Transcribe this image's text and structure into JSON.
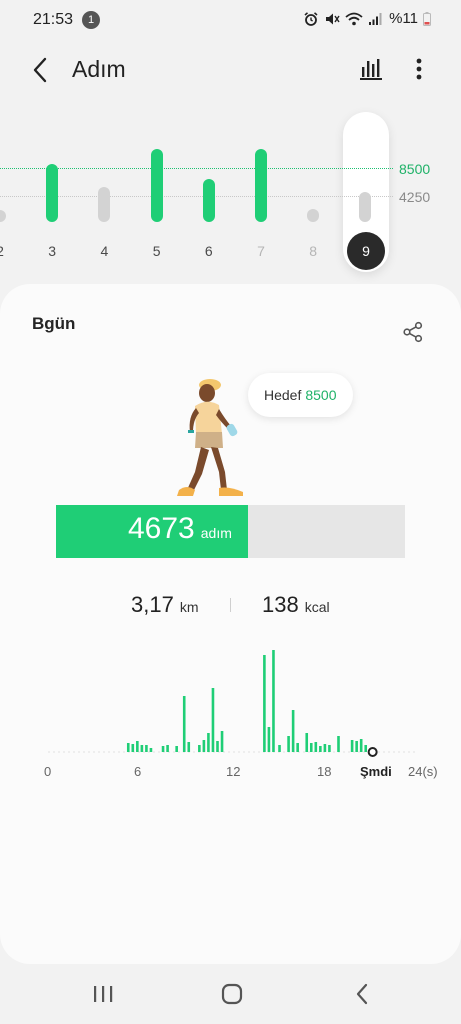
{
  "status_bar": {
    "time": "21:53",
    "notification_count": "1",
    "battery": "%11"
  },
  "app_bar": {
    "title": "Adım"
  },
  "week": {
    "goal_label": "8500",
    "half_goal_label": "4250",
    "selected_day": "9",
    "days": [
      {
        "label": "2",
        "steps": 1100,
        "reached": false,
        "dim": false
      },
      {
        "label": "3",
        "steps": 9100,
        "reached": true,
        "dim": false
      },
      {
        "label": "4",
        "steps": 5500,
        "reached": false,
        "dim": false
      },
      {
        "label": "5",
        "steps": 11500,
        "reached": true,
        "dim": false
      },
      {
        "label": "6",
        "steps": 6800,
        "reached": true,
        "dim": false
      },
      {
        "label": "7",
        "steps": 11500,
        "reached": true,
        "dim": true
      },
      {
        "label": "8",
        "steps": 2000,
        "reached": false,
        "dim": true
      },
      {
        "label": "9",
        "steps": 4673,
        "reached": false,
        "dim": false
      }
    ]
  },
  "today": {
    "title": "Bgün",
    "goal_text": "Hedef",
    "goal_value": "8500",
    "steps": "4673",
    "steps_unit": "adım",
    "progress_fraction": 0.55,
    "distance": "3,17",
    "distance_unit": "km",
    "calories": "138",
    "calories_unit": "kcal"
  },
  "chart_data": {
    "type": "bar",
    "x_ticks": [
      "0",
      "6",
      "12",
      "18",
      "Şmdi",
      "24(s)"
    ],
    "xlim": [
      0,
      24
    ],
    "ylim": [
      0,
      100
    ],
    "bars": [
      {
        "x": 5.3,
        "y": 9
      },
      {
        "x": 5.6,
        "y": 8
      },
      {
        "x": 5.9,
        "y": 11
      },
      {
        "x": 6.2,
        "y": 7
      },
      {
        "x": 6.5,
        "y": 7
      },
      {
        "x": 6.8,
        "y": 4
      },
      {
        "x": 7.6,
        "y": 6
      },
      {
        "x": 7.9,
        "y": 7
      },
      {
        "x": 8.5,
        "y": 6
      },
      {
        "x": 9.0,
        "y": 56
      },
      {
        "x": 9.3,
        "y": 10
      },
      {
        "x": 10.0,
        "y": 7
      },
      {
        "x": 10.3,
        "y": 12
      },
      {
        "x": 10.6,
        "y": 19
      },
      {
        "x": 10.9,
        "y": 64
      },
      {
        "x": 11.2,
        "y": 11
      },
      {
        "x": 11.5,
        "y": 21
      },
      {
        "x": 14.3,
        "y": 97
      },
      {
        "x": 14.6,
        "y": 25
      },
      {
        "x": 14.9,
        "y": 102
      },
      {
        "x": 15.3,
        "y": 7
      },
      {
        "x": 15.9,
        "y": 16
      },
      {
        "x": 16.2,
        "y": 42
      },
      {
        "x": 16.5,
        "y": 9
      },
      {
        "x": 17.1,
        "y": 19
      },
      {
        "x": 17.4,
        "y": 9
      },
      {
        "x": 17.7,
        "y": 10
      },
      {
        "x": 18.0,
        "y": 6
      },
      {
        "x": 18.3,
        "y": 8
      },
      {
        "x": 18.6,
        "y": 7
      },
      {
        "x": 19.2,
        "y": 16
      },
      {
        "x": 20.1,
        "y": 12
      },
      {
        "x": 20.4,
        "y": 11
      },
      {
        "x": 20.7,
        "y": 13
      },
      {
        "x": 21.0,
        "y": 7
      }
    ],
    "now_x": 21.2,
    "bar_color": "#1fce76"
  },
  "colors": {
    "accent": "#1fce76",
    "accent_text": "#1fb268",
    "inactive_bar": "#d3d3d3"
  },
  "icons": {
    "back": "chevron-left-icon",
    "chart": "bar-chart-icon",
    "more": "more-vert-icon",
    "share": "share-icon"
  }
}
